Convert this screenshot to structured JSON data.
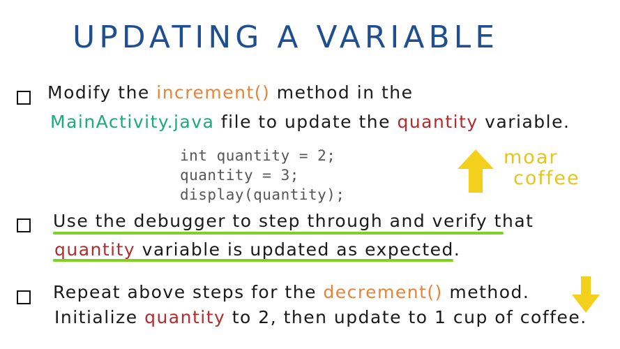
{
  "title": "UPDATING A VARIABLE",
  "colors": {
    "title": "#1f4f8f",
    "method": "#e8833a",
    "variable": "#b52a2a",
    "file": "#1aab7a",
    "code": "#555555",
    "highlight": "#7ed321",
    "note": "#e3c420",
    "arrow": "#f2d01c"
  },
  "tasks": [
    {
      "line1": {
        "pre": "Modify the ",
        "method": "increment()",
        "post": " method in the"
      },
      "line2": {
        "file": "MainActivity.java",
        "mid": " file to update the ",
        "variable": "quantity",
        "post": " variable."
      }
    },
    {
      "line1": {
        "text": "Use the debugger to step through and verify",
        "post": " that"
      },
      "line2": {
        "variable": "quantity",
        "text": " variable is updated as expected."
      }
    },
    {
      "line1": {
        "pre": "Repeat above steps for the ",
        "method": "decrement()",
        "post": " method."
      },
      "line2": {
        "pre": "Initialize ",
        "variable": "quantity",
        "post": " to 2, then update to 1 cup of coffee."
      }
    }
  ],
  "code": [
    "int quantity = 2;",
    "quantity = 3;",
    "display(quantity);"
  ],
  "note": {
    "line1": "moar",
    "line2": "coffee"
  },
  "icons": {
    "up": "up-arrow-icon",
    "down": "down-arrow-icon"
  }
}
